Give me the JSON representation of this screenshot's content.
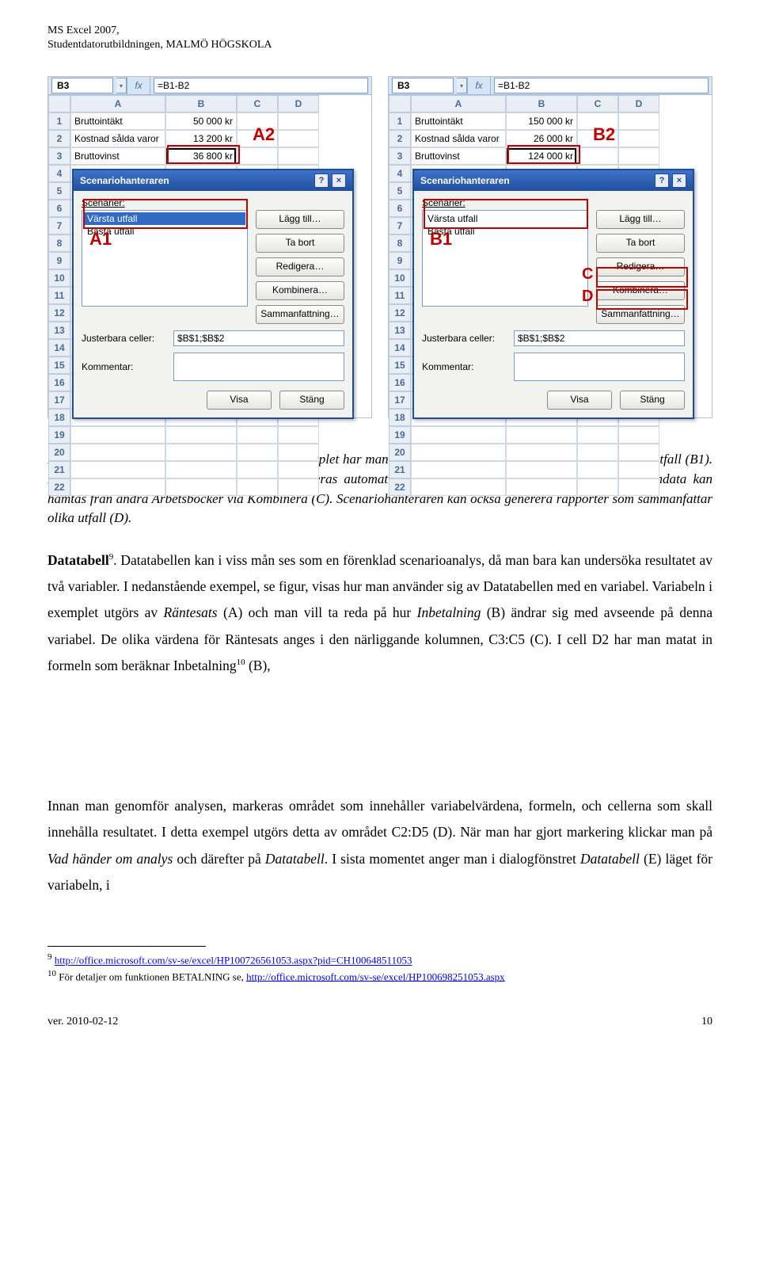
{
  "header": {
    "line1": "MS Excel 2007,",
    "line2": "Studentdatorutbildningen, MALMÖ HÖGSKOLA"
  },
  "shots": {
    "namebox": "B3",
    "fx_label": "fx",
    "formula": "=B1-B2",
    "cols": [
      "A",
      "B",
      "C",
      "D"
    ],
    "rows": [
      "1",
      "2",
      "3",
      "4",
      "5",
      "6",
      "7",
      "8",
      "9",
      "10",
      "11",
      "12",
      "13",
      "14",
      "15",
      "16",
      "17",
      "18",
      "19",
      "20",
      "21",
      "22"
    ],
    "data_rows": [
      {
        "a": "Bruttointäkt",
        "b_left": "50 000 kr",
        "b_right": "150 000 kr"
      },
      {
        "a": "Kostnad sålda varor",
        "b_left": "13 200 kr",
        "b_right": "26 000 kr"
      },
      {
        "a": "Bruttovinst",
        "b_left": "36 800 kr",
        "b_right": "124 000 kr"
      }
    ],
    "dialog": {
      "title": "Scenariohanteraren",
      "scen_label": "Scenarier:",
      "items": [
        "Värsta utfall",
        "Bästa utfall"
      ],
      "selected_left": 0,
      "selected_right": -1,
      "buttons": {
        "add": "Lägg till…",
        "del": "Ta bort",
        "edit": "Redigera…",
        "merge": "Kombinera…",
        "summary": "Sammanfattning…"
      },
      "cells_label": "Justerbara celler:",
      "cells_value": "$B$1;$B$2",
      "comment_label": "Kommentar:",
      "show": "Visa",
      "close": "Stäng"
    },
    "overlays": {
      "A1": "A1",
      "A2": "A2",
      "B1": "B1",
      "B2": "B2",
      "C": "C",
      "D": "D"
    }
  },
  "caption_parts": {
    "p1": "Figur. Användning av Scenariohanteraren. I exemplet har man definierat två scenarios; Värsta (A1) och Bästa utfall (B1). Resultatet, dvs. Bruttovinsten (=B1-B2) uppdateras automatiskt (A2 respektive B2) utifrån valt scenario. Indata kan hämtas från andra Arbetsböcker via Kombinera (C). Scenariohanteraren kan också generera rapporter som sammanfattar olika utfall (D)."
  },
  "para1": {
    "lead_bold": "Datatabell",
    "sup": "9",
    "text": ". Datatabellen kan i viss mån ses som en förenklad scenarioanalys, då man bara kan undersöka resultatet av två variabler. I nedanstående exempel, se figur, visas hur man använder sig av Datatabellen med en variabel. Variabeln i exemplet utgörs av ",
    "it1": "Räntesats",
    "t2": " (A) och man vill ta reda på hur ",
    "it2": "Inbetalning",
    "t3": " (B) ändrar sig med avseende på denna variabel. De olika värdena för Räntesats anges i den närliggande kolumnen, C3:C5 (C). I cell D2 har man matat in formeln som beräknar Inbetalning",
    "sup2": "10",
    "t4": " (B),"
  },
  "para2": {
    "t1": "Innan man genomför analysen, markeras området som innehåller variabelvärdena, formeln, och cellerna som skall innehålla resultatet. I detta exempel utgörs detta av området C2:D5 (D). När man har gjort markering klickar man på ",
    "it1": "Vad händer om analys",
    "t2": " och därefter på ",
    "it2": "Datatabell",
    "t3": ". I sista momentet anger man i dialogfönstret ",
    "it3": "Datatabell",
    "t4": " (E) läget för variabeln, i"
  },
  "footnotes": {
    "f9_num": "9",
    "f9_link": "http://office.microsoft.com/sv-se/excel/HP100726561053.aspx?pid=CH100648511053",
    "f10_num": "10",
    "f10_pre": " För detaljer om funktionen BETALNING se, ",
    "f10_link": "http://office.microsoft.com/sv-se/excel/HP100698251053.aspx"
  },
  "footer": {
    "ver": "ver. 2010-02-12",
    "page": "10"
  }
}
